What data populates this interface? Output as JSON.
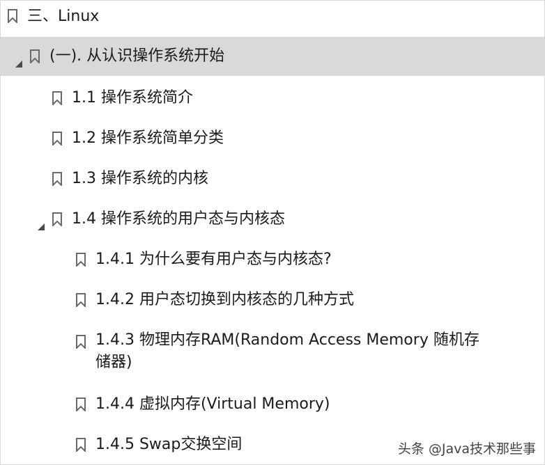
{
  "outline": {
    "root": {
      "label": "三、Linux"
    },
    "chapter": {
      "label": "(一). 从认识操作系统开始"
    },
    "items": [
      {
        "label": "1.1 操作系统简介"
      },
      {
        "label": "1.2 操作系统简单分类"
      },
      {
        "label": "1.3 操作系统的内核"
      },
      {
        "label": "1.4 操作系统的用户态与内核态"
      }
    ],
    "subitems": [
      {
        "label": "1.4.1 为什么要有用户态与内核态?"
      },
      {
        "label": "1.4.2 用户态切换到内核态的几种方式"
      },
      {
        "label": "1.4.3 物理内存RAM(Random Access Memory 随机存储器)"
      },
      {
        "label": "1.4.4 虚拟内存(Virtual Memory)"
      },
      {
        "label": "1.4.5 Swap交换空间"
      }
    ]
  },
  "watermark": "头条 @Java技术那些事",
  "colors": {
    "selected_bg": "#d9d9d9",
    "icon": "#6a6a6a",
    "text": "#1a1a1a"
  }
}
